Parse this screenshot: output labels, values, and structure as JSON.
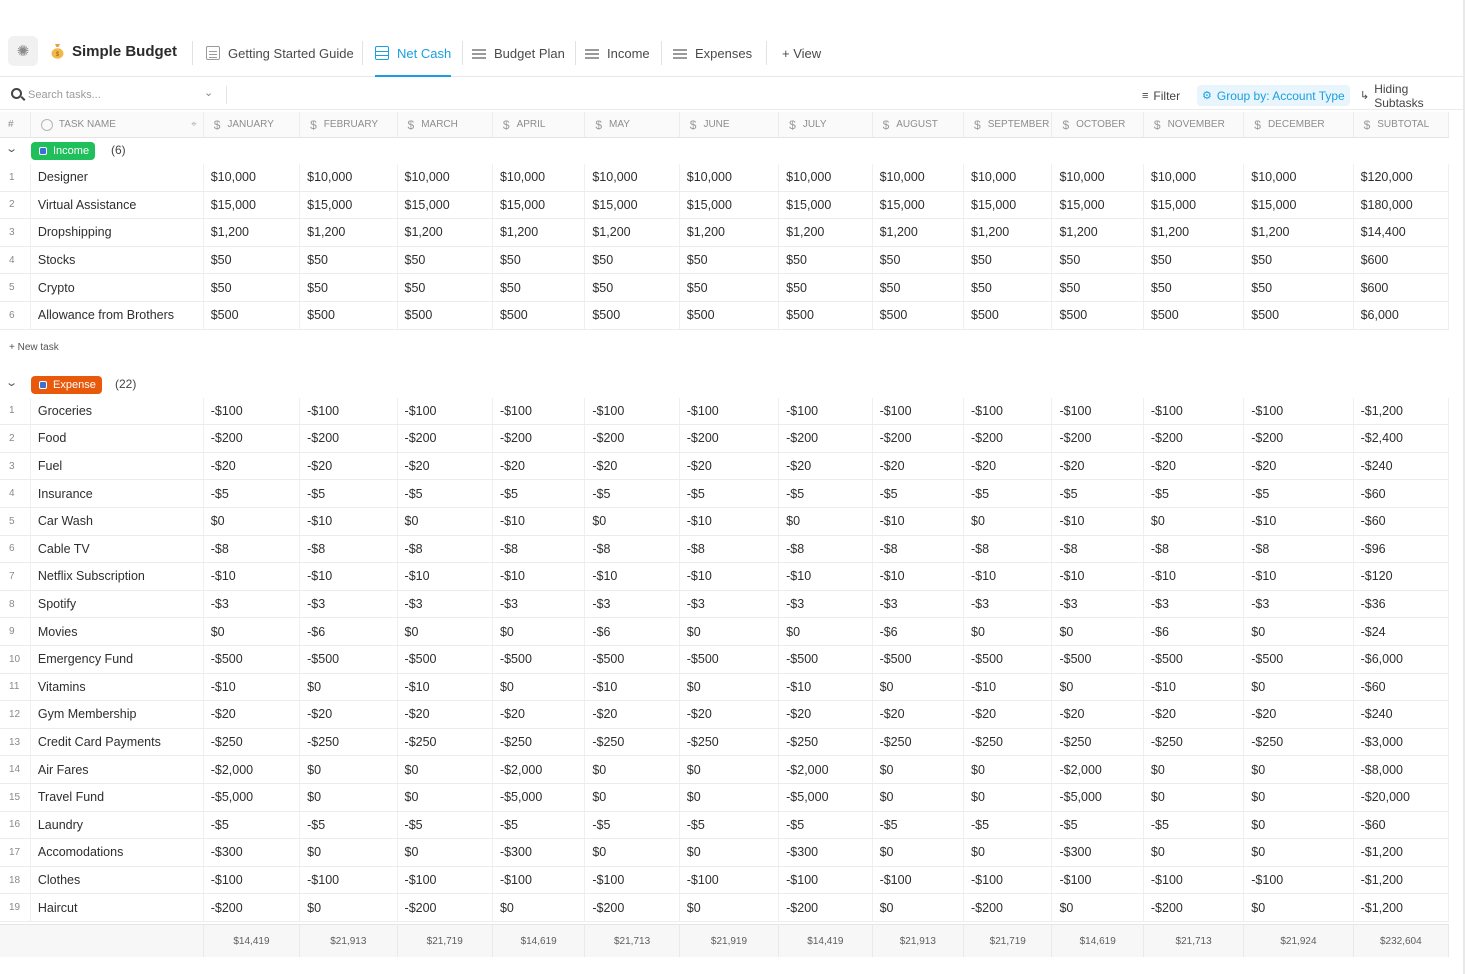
{
  "space": {
    "name": "Simple Budget"
  },
  "tabs": [
    {
      "label": "Getting Started Guide",
      "icon": "doc-icon",
      "active": false
    },
    {
      "label": "Net Cash",
      "icon": "table-icon",
      "active": true
    },
    {
      "label": "Budget Plan",
      "icon": "list-icon",
      "active": false
    },
    {
      "label": "Income",
      "icon": "list-icon",
      "active": false
    },
    {
      "label": "Expenses",
      "icon": "list-icon",
      "active": false
    }
  ],
  "add_view_label": "+ View",
  "toolbar": {
    "search_placeholder": "Search tasks...",
    "filter_label": "Filter",
    "group_label": "Group by: Account Type",
    "subtasks_label": "Hiding Subtasks"
  },
  "table": {
    "index_header": "#",
    "name_header": "TASK NAME",
    "month_headers": [
      "JANUARY",
      "FEBRUARY",
      "MARCH",
      "APRIL",
      "MAY",
      "JUNE",
      "JULY",
      "AUGUST",
      "SEPTEMBER",
      "OCTOBER",
      "NOVEMBER",
      "DECEMBER",
      "SUBTOTAL"
    ]
  },
  "groups": [
    {
      "label": "Income",
      "count": "(6)",
      "color": "#1fbf5b",
      "new_task_label": "+ New task",
      "rows": [
        {
          "name": "Designer",
          "values": [
            "$10,000",
            "$10,000",
            "$10,000",
            "$10,000",
            "$10,000",
            "$10,000",
            "$10,000",
            "$10,000",
            "$10,000",
            "$10,000",
            "$10,000",
            "$10,000",
            "$120,000"
          ]
        },
        {
          "name": "Virtual Assistance",
          "values": [
            "$15,000",
            "$15,000",
            "$15,000",
            "$15,000",
            "$15,000",
            "$15,000",
            "$15,000",
            "$15,000",
            "$15,000",
            "$15,000",
            "$15,000",
            "$15,000",
            "$180,000"
          ]
        },
        {
          "name": "Dropshipping",
          "values": [
            "$1,200",
            "$1,200",
            "$1,200",
            "$1,200",
            "$1,200",
            "$1,200",
            "$1,200",
            "$1,200",
            "$1,200",
            "$1,200",
            "$1,200",
            "$1,200",
            "$14,400"
          ]
        },
        {
          "name": "Stocks",
          "values": [
            "$50",
            "$50",
            "$50",
            "$50",
            "$50",
            "$50",
            "$50",
            "$50",
            "$50",
            "$50",
            "$50",
            "$50",
            "$600"
          ]
        },
        {
          "name": "Crypto",
          "values": [
            "$50",
            "$50",
            "$50",
            "$50",
            "$50",
            "$50",
            "$50",
            "$50",
            "$50",
            "$50",
            "$50",
            "$50",
            "$600"
          ]
        },
        {
          "name": "Allowance from Brothers",
          "values": [
            "$500",
            "$500",
            "$500",
            "$500",
            "$500",
            "$500",
            "$500",
            "$500",
            "$500",
            "$500",
            "$500",
            "$500",
            "$6,000"
          ]
        }
      ]
    },
    {
      "label": "Expense",
      "count": "(22)",
      "color": "#e8590c",
      "rows": [
        {
          "name": "Groceries",
          "values": [
            "-$100",
            "-$100",
            "-$100",
            "-$100",
            "-$100",
            "-$100",
            "-$100",
            "-$100",
            "-$100",
            "-$100",
            "-$100",
            "-$100",
            "-$1,200"
          ]
        },
        {
          "name": "Food",
          "values": [
            "-$200",
            "-$200",
            "-$200",
            "-$200",
            "-$200",
            "-$200",
            "-$200",
            "-$200",
            "-$200",
            "-$200",
            "-$200",
            "-$200",
            "-$2,400"
          ]
        },
        {
          "name": "Fuel",
          "values": [
            "-$20",
            "-$20",
            "-$20",
            "-$20",
            "-$20",
            "-$20",
            "-$20",
            "-$20",
            "-$20",
            "-$20",
            "-$20",
            "-$20",
            "-$240"
          ]
        },
        {
          "name": "Insurance",
          "values": [
            "-$5",
            "-$5",
            "-$5",
            "-$5",
            "-$5",
            "-$5",
            "-$5",
            "-$5",
            "-$5",
            "-$5",
            "-$5",
            "-$5",
            "-$60"
          ]
        },
        {
          "name": "Car Wash",
          "values": [
            "$0",
            "-$10",
            "$0",
            "-$10",
            "$0",
            "-$10",
            "$0",
            "-$10",
            "$0",
            "-$10",
            "$0",
            "-$10",
            "-$60"
          ]
        },
        {
          "name": "Cable TV",
          "values": [
            "-$8",
            "-$8",
            "-$8",
            "-$8",
            "-$8",
            "-$8",
            "-$8",
            "-$8",
            "-$8",
            "-$8",
            "-$8",
            "-$8",
            "-$96"
          ]
        },
        {
          "name": "Netflix Subscription",
          "values": [
            "-$10",
            "-$10",
            "-$10",
            "-$10",
            "-$10",
            "-$10",
            "-$10",
            "-$10",
            "-$10",
            "-$10",
            "-$10",
            "-$10",
            "-$120"
          ]
        },
        {
          "name": "Spotify",
          "values": [
            "-$3",
            "-$3",
            "-$3",
            "-$3",
            "-$3",
            "-$3",
            "-$3",
            "-$3",
            "-$3",
            "-$3",
            "-$3",
            "-$3",
            "-$36"
          ]
        },
        {
          "name": "Movies",
          "values": [
            "$0",
            "-$6",
            "$0",
            "$0",
            "-$6",
            "$0",
            "$0",
            "-$6",
            "$0",
            "$0",
            "-$6",
            "$0",
            "-$24"
          ]
        },
        {
          "name": "Emergency Fund",
          "values": [
            "-$500",
            "-$500",
            "-$500",
            "-$500",
            "-$500",
            "-$500",
            "-$500",
            "-$500",
            "-$500",
            "-$500",
            "-$500",
            "-$500",
            "-$6,000"
          ]
        },
        {
          "name": "Vitamins",
          "values": [
            "-$10",
            "$0",
            "-$10",
            "$0",
            "-$10",
            "$0",
            "-$10",
            "$0",
            "-$10",
            "$0",
            "-$10",
            "$0",
            "-$60"
          ]
        },
        {
          "name": "Gym Membership",
          "values": [
            "-$20",
            "-$20",
            "-$20",
            "-$20",
            "-$20",
            "-$20",
            "-$20",
            "-$20",
            "-$20",
            "-$20",
            "-$20",
            "-$20",
            "-$240"
          ]
        },
        {
          "name": "Credit Card Payments",
          "values": [
            "-$250",
            "-$250",
            "-$250",
            "-$250",
            "-$250",
            "-$250",
            "-$250",
            "-$250",
            "-$250",
            "-$250",
            "-$250",
            "-$250",
            "-$3,000"
          ]
        },
        {
          "name": "Air Fares",
          "values": [
            "-$2,000",
            "$0",
            "$0",
            "-$2,000",
            "$0",
            "$0",
            "-$2,000",
            "$0",
            "$0",
            "-$2,000",
            "$0",
            "$0",
            "-$8,000"
          ]
        },
        {
          "name": "Travel Fund",
          "values": [
            "-$5,000",
            "$0",
            "$0",
            "-$5,000",
            "$0",
            "$0",
            "-$5,000",
            "$0",
            "$0",
            "-$5,000",
            "$0",
            "$0",
            "-$20,000"
          ]
        },
        {
          "name": "Laundry",
          "values": [
            "-$5",
            "-$5",
            "-$5",
            "-$5",
            "-$5",
            "-$5",
            "-$5",
            "-$5",
            "-$5",
            "-$5",
            "-$5",
            "$0",
            "-$60"
          ]
        },
        {
          "name": "Accomodations",
          "values": [
            "-$300",
            "$0",
            "$0",
            "-$300",
            "$0",
            "$0",
            "-$300",
            "$0",
            "$0",
            "-$300",
            "$0",
            "$0",
            "-$1,200"
          ]
        },
        {
          "name": "Clothes",
          "values": [
            "-$100",
            "-$100",
            "-$100",
            "-$100",
            "-$100",
            "-$100",
            "-$100",
            "-$100",
            "-$100",
            "-$100",
            "-$100",
            "-$100",
            "-$1,200"
          ]
        },
        {
          "name": "Haircut",
          "values": [
            "-$200",
            "$0",
            "-$200",
            "$0",
            "-$200",
            "$0",
            "-$200",
            "$0",
            "-$200",
            "$0",
            "-$200",
            "$0",
            "-$1,200"
          ]
        }
      ]
    }
  ],
  "totals": [
    "$14,419",
    "$21,913",
    "$21,719",
    "$14,619",
    "$21,713",
    "$21,919",
    "$14,419",
    "$21,913",
    "$21,719",
    "$14,619",
    "$21,713",
    "$21,924",
    "$232,604"
  ]
}
